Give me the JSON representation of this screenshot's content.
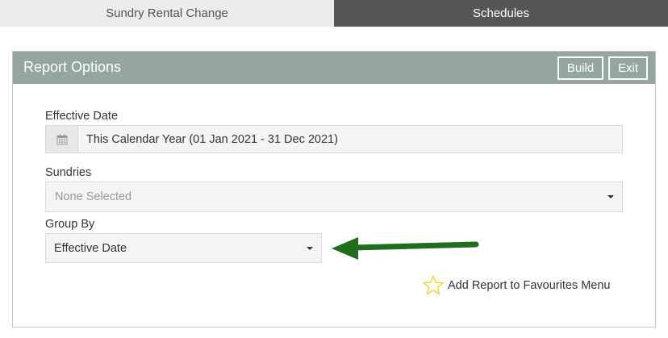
{
  "tabs": [
    {
      "label": "Sundry Rental Change",
      "active": false
    },
    {
      "label": "Schedules",
      "active": true
    }
  ],
  "panel": {
    "title": "Report Options",
    "build_label": "Build",
    "exit_label": "Exit"
  },
  "fields": {
    "effective_date": {
      "label": "Effective Date",
      "value": "This Calendar Year (01 Jan 2021 - 31 Dec 2021)",
      "icon": "calendar-icon"
    },
    "sundries": {
      "label": "Sundries",
      "placeholder": "None Selected"
    },
    "group_by": {
      "label": "Group By",
      "value": "Effective Date"
    }
  },
  "favourites": {
    "label": "Add Report to Favourites Menu",
    "icon": "star-outline-icon"
  },
  "colors": {
    "header_bg": "#95a5a2",
    "active_tab_bg": "#565656",
    "arrow": "#1e6e1e",
    "star": "#f2d31a"
  }
}
